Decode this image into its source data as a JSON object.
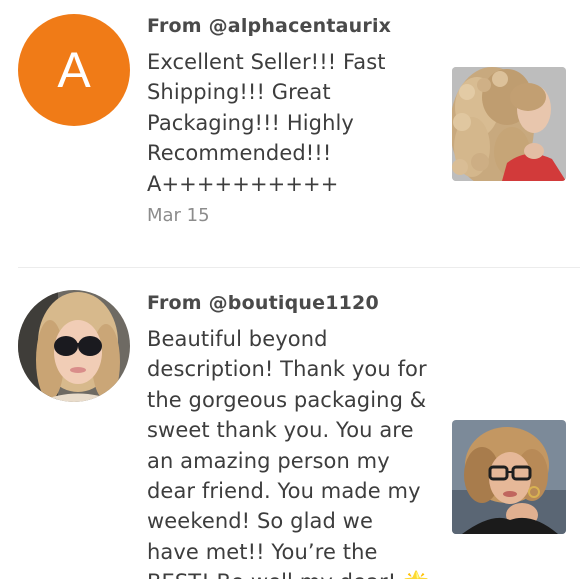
{
  "reviews": [
    {
      "author": "From @alphacentaurix",
      "avatar_letter": "A",
      "avatar_color": "#f07b17",
      "text": "Excellent Seller!!! Fast\nShipping!!! Great\nPackaging!!! Highly\nRecommended!!!\nA++++++++++",
      "date": "Mar 15",
      "avatar_icon": "letter-avatar-icon",
      "thumbnail_icon": "curly-blonde-wig-photo"
    },
    {
      "author": "From @boutique1120",
      "text": "Beautiful beyond\ndescription! Thank you for\nthe gorgeous packaging &\nsweet thank you. You are\nan amazing person my\ndear friend. You made my\nweekend! So glad we\nhave met!! You’re the\nBEST! Be well my dear! 🌟",
      "avatar_icon": "sunglasses-woman-avatar-photo",
      "thumbnail_icon": "glasses-woman-wig-photo"
    }
  ],
  "colors": {
    "accent": "#f07b17",
    "divider": "#ececec",
    "date": "#8c8c8c"
  }
}
